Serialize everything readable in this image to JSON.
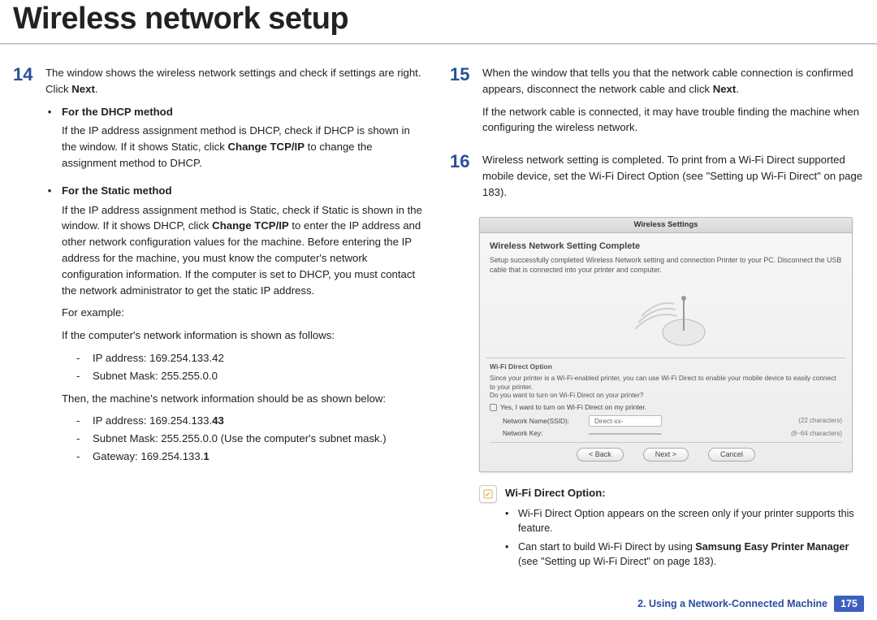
{
  "title": "Wireless network setup",
  "left": {
    "step14": {
      "num": "14",
      "intro_a": "The window shows the wireless network settings and check if settings are right. Click ",
      "intro_bold": "Next",
      "intro_b": ".",
      "dhcp": {
        "title": "For the DHCP method",
        "text_a": "If the IP address assignment method is DHCP, check if DHCP is shown in the window. If it shows Static, click ",
        "bold": "Change TCP/IP",
        "text_b": " to change the assignment method to DHCP."
      },
      "static": {
        "title": "For the Static method",
        "text_a": "If the IP address assignment method is Static, check if Static is shown in the window. If it shows DHCP, click ",
        "bold": "Change TCP/IP",
        "text_b": " to enter the IP address and other network configuration values for the machine. Before entering the IP address for the machine, you must know the computer's network configuration information. If the computer is set to DHCP, you must contact the network administrator to get the static IP address.",
        "eg": "For example:",
        "follows": "If the computer's network information is shown as follows:",
        "list1": {
          "ip_label": "IP address: ",
          "ip_val": "169.254.133.42",
          "sm_label": "Subnet Mask: ",
          "sm_val": "255.255.0.0"
        },
        "then": "Then, the machine's network information should be as shown below:",
        "list2": {
          "ip_label": "IP address: 169.254.133.",
          "ip_bold": "43",
          "sm": "Subnet Mask: 255.255.0.0 (Use the computer's subnet mask.)",
          "gw_label": "Gateway: 169.254.133.",
          "gw_bold": "1"
        }
      }
    }
  },
  "right": {
    "step15": {
      "num": "15",
      "text_a": "When the window that tells you that the network cable connection is confirmed appears, disconnect the network cable and click ",
      "bold": "Next",
      "text_b": ".",
      "extra": "If the network cable is connected, it may have trouble finding the machine when configuring the wireless network."
    },
    "step16": {
      "num": "16",
      "text": "Wireless network setting is completed. To print from a Wi-Fi Direct supported mobile device, set the Wi-Fi Direct Option (see \"Setting up Wi-Fi Direct\" on page 183)."
    },
    "shot": {
      "titlebar": "Wireless Settings",
      "h": "Wireless Network Setting Complete",
      "p": "Setup successfully completed Wireless Network setting and connection Printer to your PC. Disconnect the USB cable that is connected into your printer and computer.",
      "section": "Wi-Fi Direct Option",
      "desc": "Since your printer is a Wi-Fi-enabled printer, you can use Wi-Fi Direct to enable your mobile device to easily connect to your printer.\nDo you want to turn on Wi-Fi Direct on your printer?",
      "cb": "Yes, I want to turn on Wi-Fi Direct on my printer.",
      "f1_name": "Network Name(SSID):",
      "f1_val": "Direct-xx-",
      "f1_hint": "(22 characters)",
      "f2_name": "Network Key:",
      "f2_val": "",
      "f2_hint": "(8~64 characters)",
      "btn_back": "< Back",
      "btn_next": "Next >",
      "btn_cancel": "Cancel"
    },
    "note": {
      "title": "Wi-Fi Direct Option:",
      "li1": "Wi-Fi Direct Option appears on the screen only if your printer supports this feature.",
      "li2_a": "Can start to build Wi-Fi Direct by using ",
      "li2_bold": "Samsung Easy Printer Manager",
      "li2_b": " (see \"Setting up Wi-Fi Direct\" on page 183)."
    }
  },
  "footer": {
    "chapter": "2.  Using a Network-Connected Machine",
    "page": "175"
  }
}
